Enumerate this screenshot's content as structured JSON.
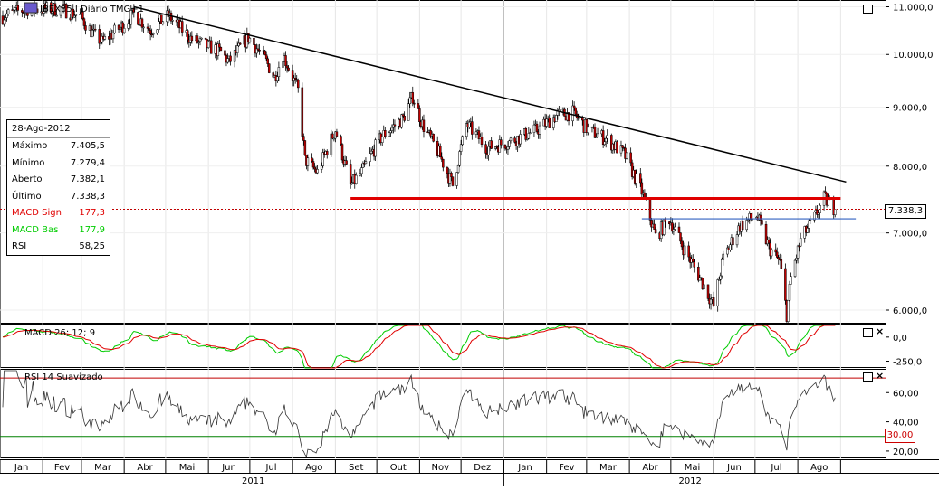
{
  "chart_data": {
    "type": "candlestick",
    "instrument_label": "IBEX35.I Diário TMG+1",
    "instrument_icon": "cfd-icon",
    "price_axis": {
      "ticks": [
        11000,
        10000,
        9000,
        8000,
        7000,
        6000
      ],
      "tick_labels": [
        "11.000,0",
        "10.000,0",
        "9.000,0",
        "8.000,0",
        "7.000,0",
        "6.000,0"
      ],
      "range": [
        5850,
        11150
      ],
      "scale": "log"
    },
    "x_axis": {
      "months": [
        "Jan",
        "Fev",
        "Mar",
        "Abr",
        "Mai",
        "Jun",
        "Jul",
        "Ago",
        "Set",
        "Out",
        "Nov",
        "Dez",
        "Jan",
        "Fev",
        "Mar",
        "Abr",
        "Mai",
        "Jun",
        "Jul",
        "Ago"
      ],
      "years": [
        "2011",
        "2012"
      ]
    },
    "close_series": {
      "start": "2011-01-03",
      "points": [
        [
          "2011-01-03",
          10800
        ],
        [
          "2011-01-20",
          10950
        ],
        [
          "2011-02-15",
          10950
        ],
        [
          "2011-02-28",
          10800
        ],
        [
          "2011-03-10",
          10400
        ],
        [
          "2011-03-16",
          10250
        ],
        [
          "2011-03-31",
          10600
        ],
        [
          "2011-04-08",
          10850
        ],
        [
          "2011-04-20",
          10500
        ],
        [
          "2011-05-03",
          10800
        ],
        [
          "2011-05-20",
          10300
        ],
        [
          "2011-06-10",
          10050
        ],
        [
          "2011-06-16",
          9850
        ],
        [
          "2011-06-30",
          10350
        ],
        [
          "2011-07-12",
          9900
        ],
        [
          "2011-07-19",
          9550
        ],
        [
          "2011-07-25",
          10000
        ],
        [
          "2011-08-05",
          9300
        ],
        [
          "2011-08-10",
          8100
        ],
        [
          "2011-08-19",
          7900
        ],
        [
          "2011-09-01",
          8600
        ],
        [
          "2011-09-12",
          7700
        ],
        [
          "2011-09-20",
          7900
        ],
        [
          "2011-09-27",
          8200
        ],
        [
          "2011-10-05",
          8500
        ],
        [
          "2011-10-20",
          8800
        ],
        [
          "2011-10-27",
          9200
        ],
        [
          "2011-11-03",
          8700
        ],
        [
          "2011-11-15",
          8200
        ],
        [
          "2011-11-25",
          7700
        ],
        [
          "2011-12-05",
          8700
        ],
        [
          "2011-12-20",
          8300
        ],
        [
          "2012-01-05",
          8400
        ],
        [
          "2012-01-25",
          8600
        ],
        [
          "2012-02-08",
          8850
        ],
        [
          "2012-02-20",
          8900
        ],
        [
          "2012-03-02",
          8600
        ],
        [
          "2012-03-15",
          8450
        ],
        [
          "2012-03-28",
          8200
        ],
        [
          "2012-04-10",
          7600
        ],
        [
          "2012-04-20",
          6950
        ],
        [
          "2012-04-30",
          7200
        ],
        [
          "2012-05-10",
          6800
        ],
        [
          "2012-05-25",
          6300
        ],
        [
          "2012-06-01",
          6050
        ],
        [
          "2012-06-08",
          6650
        ],
        [
          "2012-06-20",
          7100
        ],
        [
          "2012-07-02",
          7250
        ],
        [
          "2012-07-11",
          6800
        ],
        [
          "2012-07-19",
          6600
        ],
        [
          "2012-07-24",
          5950
        ],
        [
          "2012-07-27",
          6400
        ],
        [
          "2012-08-03",
          6900
        ],
        [
          "2012-08-14",
          7250
        ],
        [
          "2012-08-20",
          7500
        ],
        [
          "2012-08-28",
          7338
        ]
      ]
    },
    "trendlines": [
      {
        "name": "downtrend",
        "color": "#000000",
        "from": [
          "2011-04-08",
          11000
        ],
        "to": [
          "2012-09-05",
          7750
        ]
      },
      {
        "name": "support",
        "color": "#e00000",
        "from": [
          "2011-09-12",
          7500
        ],
        "to": [
          "2012-09-01",
          7500
        ]
      },
      {
        "name": "resistance",
        "color": "#3060c0",
        "from": [
          "2012-04-10",
          7200
        ],
        "to": [
          "2012-09-12",
          7200
        ]
      }
    ],
    "last_price": {
      "value": 7338.3,
      "label": "7.338,3",
      "color": "#c00000"
    },
    "macd": {
      "label": "MACD 26; 12; 9",
      "ticks": [
        0,
        -250
      ],
      "tick_labels": [
        "0,0",
        "-250,0"
      ],
      "range": [
        -320,
        120
      ],
      "signal_color": "#e00000",
      "base_color": "#00cc00"
    },
    "rsi": {
      "label": "RSI 14 Suavizado",
      "ticks": [
        60,
        40,
        20
      ],
      "tick_labels": [
        "60,00",
        "40,00",
        "20,00"
      ],
      "range": [
        15,
        75
      ],
      "upper": 70,
      "lower": 30,
      "lower_label": "30,00",
      "upper_color": "#c00000",
      "lower_color": "#008000"
    },
    "info_panel": {
      "date": "28-Ago-2012",
      "rows": [
        {
          "label": "Máximo",
          "value": "7.405,5",
          "color": "#000000"
        },
        {
          "label": "Mínimo",
          "value": "7.279,4",
          "color": "#000000"
        },
        {
          "label": "Aberto",
          "value": "7.382,1",
          "color": "#000000"
        },
        {
          "label": "Último",
          "value": "7.338,3",
          "color": "#000000"
        },
        {
          "label": "MACD Sign",
          "value": "177,3",
          "color": "#e00000"
        },
        {
          "label": "MACD Bas",
          "value": "177,9",
          "color": "#00cc00"
        },
        {
          "label": "RSI",
          "value": "58,25",
          "color": "#000000"
        }
      ]
    }
  }
}
